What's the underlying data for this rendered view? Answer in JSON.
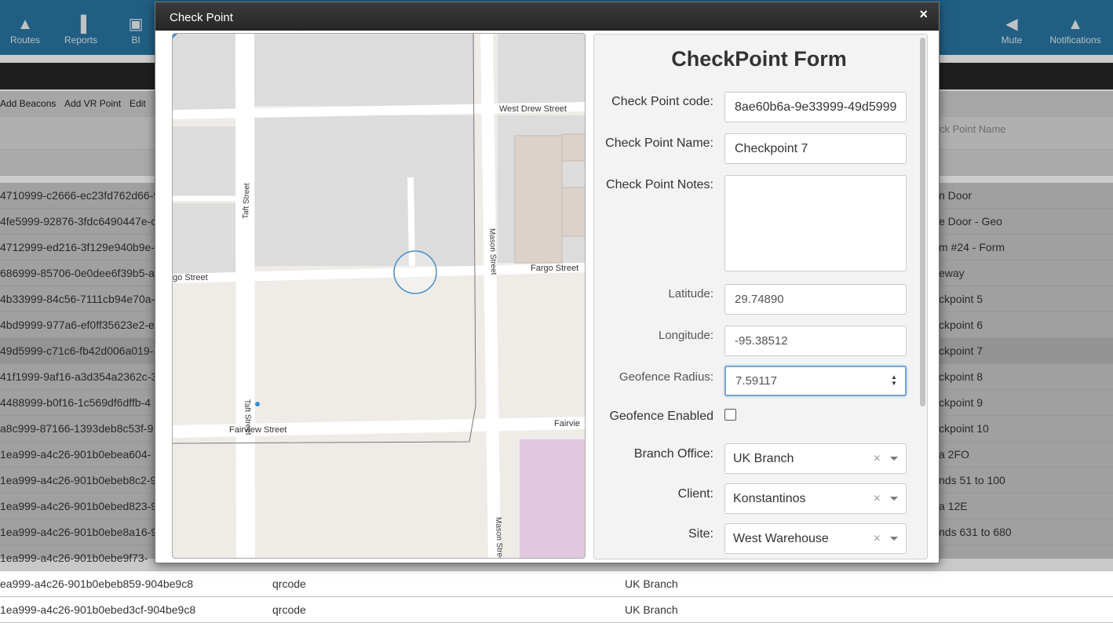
{
  "app": {
    "nav": [
      {
        "label": "Routes",
        "icon": "routes-icon",
        "glyph": "▲"
      },
      {
        "label": "Reports",
        "icon": "reports-icon",
        "glyph": "▐"
      },
      {
        "label": "BI",
        "icon": "bi-icon",
        "glyph": "▣"
      },
      {
        "label": "Mute",
        "icon": "speaker-icon",
        "glyph": "◀"
      },
      {
        "label": "Notifications",
        "icon": "bell-icon",
        "glyph": "▲"
      }
    ],
    "toolbar": [
      "Add Beacons",
      "Add VR Point",
      "Edit"
    ],
    "header_right": "ck Point Name",
    "rows": [
      {
        "code": "4710999-c2666-ec23fd762d66-9",
        "name": "n Door"
      },
      {
        "code": "4fe5999-92876-3fdc6490447e-c",
        "name": "e Door - Geo"
      },
      {
        "code": "4712999-ed216-3f129e940b9e-",
        "name": "m #24 - Form"
      },
      {
        "code": "686999-85706-0e0dee6f39b5-a",
        "name": "eway"
      },
      {
        "code": "4b33999-84c56-7111cb94e70a-",
        "name": "ckpoint 5"
      },
      {
        "code": "4bd9999-977a6-ef0ff35623e2-ea",
        "name": "ckpoint 6"
      },
      {
        "code": "49d5999-c71c6-fb42d006a019-",
        "name": "ckpoint 7"
      },
      {
        "code": "41f1999-9af16-a3d354a2362c-3",
        "name": "ckpoint 8"
      },
      {
        "code": "4488999-b0f16-1c569df6dffb-4",
        "name": "ckpoint 9"
      },
      {
        "code": "a8c999-87166-1393deb8c53f-9",
        "name": "ckpoint 10"
      },
      {
        "code": "1ea999-a4c26-901b0ebea604-",
        "name": "a 2FO"
      },
      {
        "code": "1ea999-a4c26-901b0ebeb8c2-9",
        "name": "nds 51 to 100"
      },
      {
        "code": "1ea999-a4c26-901b0ebed823-9",
        "name": "a 12E"
      },
      {
        "code": "1ea999-a4c26-901b0ebe8a16-9",
        "name": "nds 631 to 680"
      },
      {
        "code": "1ea999-a4c26-901b0ebe9f73-",
        "name": ""
      }
    ],
    "light_rows": [
      {
        "code": "ea999-a4c26-901b0ebeb859-904be9c8",
        "type": "qrcode",
        "branch": "UK Branch"
      },
      {
        "code": "1ea999-a4c26-901b0ebed3cf-904be9c8",
        "type": "qrcode",
        "branch": "UK Branch"
      }
    ]
  },
  "modal": {
    "title": "Check Point",
    "close": "×"
  },
  "map": {
    "streets": [
      "West Drew Street",
      "Taft Street",
      "Mason Street",
      "Fargo Street",
      "go Street",
      "Fairview Street",
      "Fairvie",
      "Taft Street",
      "Mason Street"
    ]
  },
  "form": {
    "title": "CheckPoint Form",
    "code_label": "Check Point code:",
    "code_value": "8ae60b6a-9e33999-49d5999",
    "name_label": "Check Point Name:",
    "name_value": "Checkpoint 7",
    "notes_label": "Check Point Notes:",
    "notes_value": "",
    "lat_label": "Latitude:",
    "lat_value": "29.74890",
    "lng_label": "Longitude:",
    "lng_value": "-95.38512",
    "radius_label": "Geofence Radius:",
    "radius_value": "7.59117",
    "geo_enabled_label": "Geofence Enabled",
    "branch_label": "Branch Office:",
    "branch_value": "UK Branch",
    "client_label": "Client:",
    "client_value": "Konstantinos",
    "site_label": "Site:",
    "site_value": "West Warehouse",
    "clear_glyph": "×"
  }
}
